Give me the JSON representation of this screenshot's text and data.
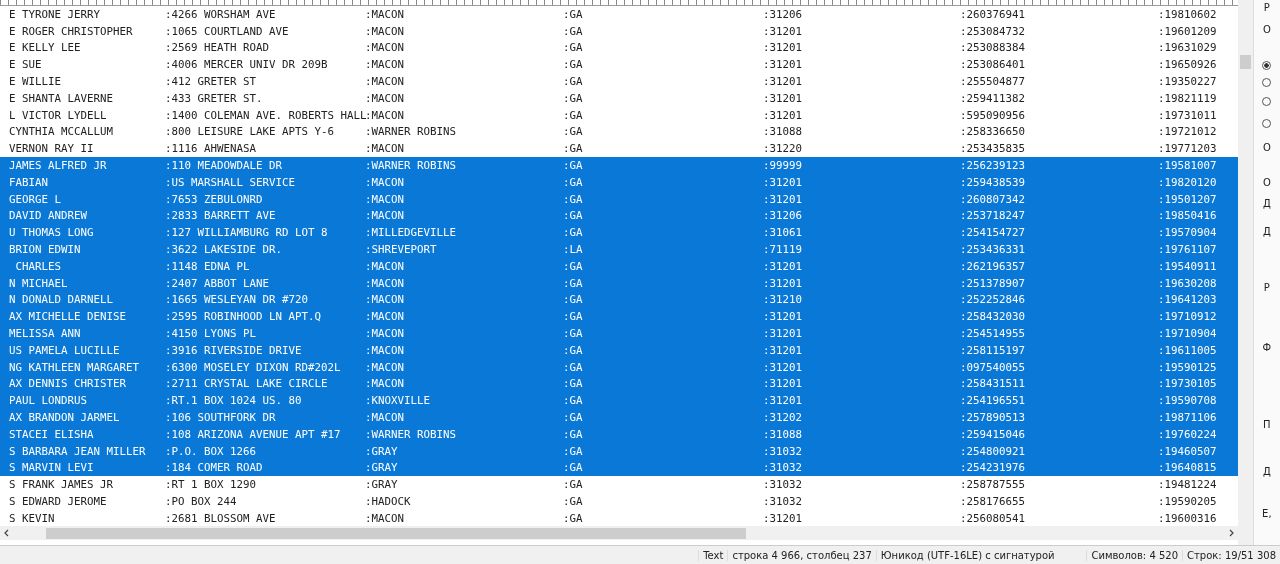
{
  "rows": [
    {
      "cells": [
        "E TYRONE JERRY",
        ":4266 WORSHAM AVE",
        ":MACON",
        ":GA",
        ":31206",
        ":260376941",
        ":19810602"
      ],
      "selected": false
    },
    {
      "cells": [
        "E ROGER CHRISTOPHER",
        ":1065 COURTLAND AVE",
        ":MACON",
        ":GA",
        ":31201",
        ":253084732",
        ":19601209"
      ],
      "selected": false
    },
    {
      "cells": [
        "E KELLY LEE",
        ":2569 HEATH ROAD",
        ":MACON",
        ":GA",
        ":31201",
        ":253088384",
        ":19631029"
      ],
      "selected": false
    },
    {
      "cells": [
        "E SUE",
        ":4006 MERCER UNIV DR 209B",
        ":MACON",
        ":GA",
        ":31201",
        ":253086401",
        ":19650926"
      ],
      "selected": false
    },
    {
      "cells": [
        "E WILLIE",
        ":412 GRETER ST",
        ":MACON",
        ":GA",
        ":31201",
        ":255504877",
        ":19350227"
      ],
      "selected": false
    },
    {
      "cells": [
        "E SHANTA LAVERNE",
        ":433 GRETER ST.",
        ":MACON",
        ":GA",
        ":31201",
        ":259411382",
        ":19821119"
      ],
      "selected": false
    },
    {
      "cells": [
        "L VICTOR LYDELL",
        ":1400 COLEMAN AVE. ROBERTS HALL",
        ":MACON",
        ":GA",
        ":31201",
        ":595090956",
        ":19731011"
      ],
      "selected": false
    },
    {
      "cells": [
        "CYNTHIA MCCALLUM",
        ":800 LEISURE LAKE APTS Y-6",
        ":WARNER ROBINS",
        ":GA",
        ":31088",
        ":258336650",
        ":19721012"
      ],
      "selected": false
    },
    {
      "cells": [
        "VERNON RAY II",
        ":1116 AHWENASA",
        ":MACON",
        ":GA",
        ":31220",
        ":253435835",
        ":19771203"
      ],
      "selected": false
    },
    {
      "cells": [
        "JAMES ALFRED JR",
        ":110 MEADOWDALE DR",
        ":WARNER ROBINS",
        ":GA",
        ":99999",
        ":256239123",
        ":19581007"
      ],
      "selected": true
    },
    {
      "cells": [
        "FABIAN",
        ":US MARSHALL SERVICE",
        ":MACON",
        ":GA",
        ":31201",
        ":259438539",
        ":19820120"
      ],
      "selected": true
    },
    {
      "cells": [
        "GEORGE L",
        ":7653 ZEBULONRD",
        ":MACON",
        ":GA",
        ":31201",
        ":260807342",
        ":19501207"
      ],
      "selected": true
    },
    {
      "cells": [
        "DAVID ANDREW",
        ":2833 BARRETT AVE",
        ":MACON",
        ":GA",
        ":31206",
        ":253718247",
        ":19850416"
      ],
      "selected": true
    },
    {
      "cells": [
        "U THOMAS LONG",
        ":127 WILLIAMBURG RD LOT 8",
        ":MILLEDGEVILLE",
        ":GA",
        ":31061",
        ":254154727",
        ":19570904"
      ],
      "selected": true
    },
    {
      "cells": [
        "BRION EDWIN",
        ":3622 LAKESIDE DR.",
        ":SHREVEPORT",
        ":LA",
        ":71119",
        ":253436331",
        ":19761107"
      ],
      "selected": true
    },
    {
      "cells": [
        " CHARLES",
        ":1148 EDNA PL",
        ":MACON",
        ":GA",
        ":31201",
        ":262196357",
        ":19540911"
      ],
      "selected": true
    },
    {
      "cells": [
        "N MICHAEL",
        ":2407 ABBOT LANE",
        ":MACON",
        ":GA",
        ":31201",
        ":251378907",
        ":19630208"
      ],
      "selected": true
    },
    {
      "cells": [
        "N DONALD DARNELL",
        ":1665 WESLEYAN DR #720",
        ":MACON",
        ":GA",
        ":31210",
        ":252252846",
        ":19641203"
      ],
      "selected": true
    },
    {
      "cells": [
        "AX MICHELLE DENISE",
        ":2595 ROBINHOOD LN APT.Q",
        ":MACON",
        ":GA",
        ":31201",
        ":258432030",
        ":19710912"
      ],
      "selected": true
    },
    {
      "cells": [
        "MELISSA ANN",
        ":4150 LYONS PL",
        ":MACON",
        ":GA",
        ":31201",
        ":254514955",
        ":19710904"
      ],
      "selected": true
    },
    {
      "cells": [
        "US PAMELA LUCILLE",
        ":3916 RIVERSIDE DRIVE",
        ":MACON",
        ":GA",
        ":31201",
        ":258115197",
        ":19611005"
      ],
      "selected": true
    },
    {
      "cells": [
        "NG KATHLEEN MARGARET",
        ":6300 MOSELEY DIXON RD#202L",
        ":MACON",
        ":GA",
        ":31201",
        ":097540055",
        ":19590125"
      ],
      "selected": true
    },
    {
      "cells": [
        "AX DENNIS CHRISTER",
        ":2711 CRYSTAL LAKE CIRCLE",
        ":MACON",
        ":GA",
        ":31201",
        ":258431511",
        ":19730105"
      ],
      "selected": true
    },
    {
      "cells": [
        "PAUL LONDRUS",
        ":RT.1 BOX 1024 US. 80",
        ":KNOXVILLE",
        ":GA",
        ":31201",
        ":254196551",
        ":19590708"
      ],
      "selected": true
    },
    {
      "cells": [
        "AX BRANDON JARMEL",
        ":106 SOUTHFORK DR",
        ":MACON",
        ":GA",
        ":31202",
        ":257890513",
        ":19871106"
      ],
      "selected": true
    },
    {
      "cells": [
        "STACEI ELISHA",
        ":108 ARIZONA AVENUE APT #17",
        ":WARNER ROBINS",
        ":GA",
        ":31088",
        ":259415046",
        ":19760224"
      ],
      "selected": true
    },
    {
      "cells": [
        "S BARBARA JEAN MILLER",
        ":P.O. BOX 1266",
        ":GRAY",
        ":GA",
        ":31032",
        ":254800921",
        ":19460507"
      ],
      "selected": true
    },
    {
      "cells": [
        "S MARVIN LEVI",
        ":184 COMER ROAD",
        ":GRAY",
        ":GA",
        ":31032",
        ":254231976",
        ":19640815"
      ],
      "selected": true
    },
    {
      "cells": [
        "S FRANK JAMES JR",
        ":RT 1 BOX 1290",
        ":GRAY",
        ":GA",
        ":31032",
        ":258787555",
        ":19481224"
      ],
      "selected": false
    },
    {
      "cells": [
        "S EDWARD JEROME",
        ":PO BOX 244",
        ":HADOCK",
        ":GA",
        ":31032",
        ":258176655",
        ":19590205"
      ],
      "selected": false
    },
    {
      "cells": [
        "S KEVIN",
        ":2681 BLOSSOM AVE",
        ":MACON",
        ":GA",
        ":31201",
        ":256080541",
        ":19600316"
      ],
      "selected": false
    }
  ],
  "side_panel": [
    {
      "kind": "label",
      "text": "Р"
    },
    {
      "kind": "label",
      "text": "О"
    },
    {
      "kind": "radio",
      "selected": true
    },
    {
      "kind": "radio",
      "selected": false
    },
    {
      "kind": "radio",
      "selected": false
    },
    {
      "kind": "radio",
      "selected": false
    },
    {
      "kind": "label",
      "text": "О"
    },
    {
      "kind": "label",
      "text": "О"
    },
    {
      "kind": "label",
      "text": "Д"
    },
    {
      "kind": "label",
      "text": "Д"
    },
    {
      "kind": "label",
      "text": "Р"
    },
    {
      "kind": "label",
      "text": "Ф"
    },
    {
      "kind": "label",
      "text": "П"
    },
    {
      "kind": "label",
      "text": "Д"
    },
    {
      "kind": "label",
      "text": "Е,"
    }
  ],
  "status_bar": [
    "Text",
    "строка 4 966, столбец 237",
    "Юникод (UTF-16LE) с сигнатурой",
    "Символов: 4 520",
    "Строк: 19/51 308"
  ]
}
